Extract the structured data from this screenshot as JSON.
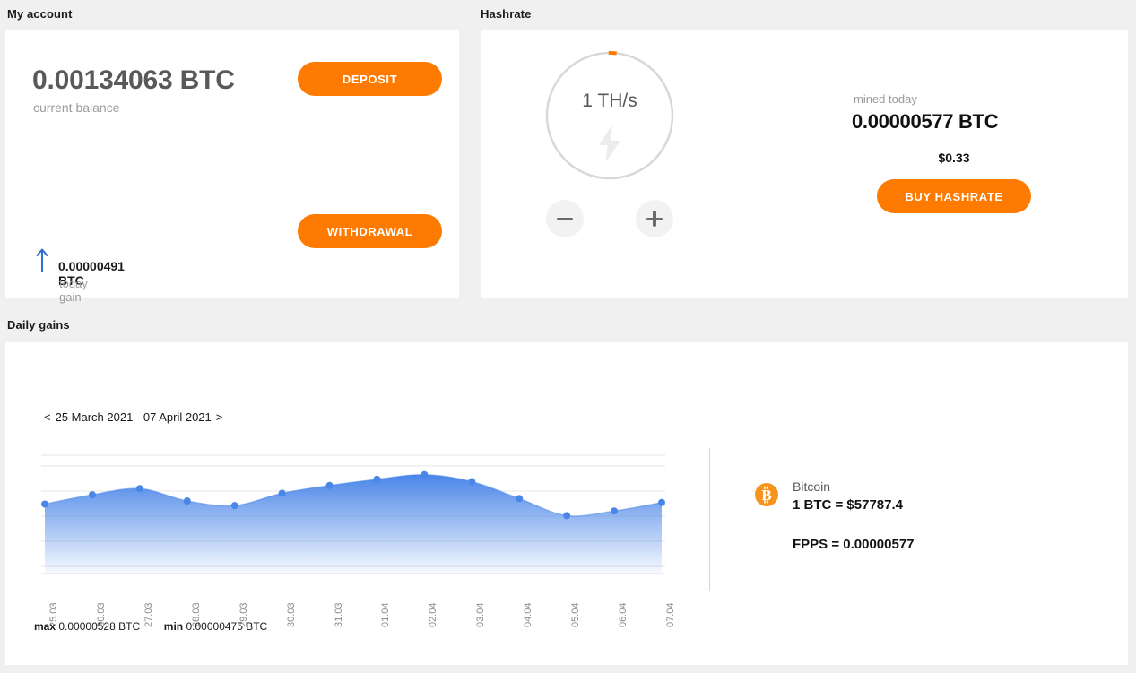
{
  "theme": {
    "accent_orange": "#ff7a00",
    "chart_blue": "#4a86e8",
    "background": "#f0f0f0",
    "panel": "#ffffff"
  },
  "account": {
    "section_title": "My account",
    "balance_amount": "0.00134063 BTC",
    "balance_label": "current balance",
    "deposit_label": "DEPOSIT",
    "withdrawal_label": "WITHDRAWAL",
    "gain_amount": "0.00000491 BTC",
    "gain_label": "today gain",
    "gain_direction_icon": "arrow-up-icon"
  },
  "hashrate": {
    "section_title": "Hashrate",
    "gauge_value": "1 TH/s",
    "gauge_icon": "lightning-bolt-icon",
    "gauge_percent": 2,
    "decrease_label": "−",
    "increase_label": "+",
    "mined_label": "mined today",
    "mined_amount": "0.00000577 BTC",
    "mined_usd": "$0.33",
    "buy_label": "BUY HASHRATE"
  },
  "daily_gains": {
    "section_title": "Daily gains",
    "prev_arrow": "<",
    "next_arrow": ">",
    "date_range": "25 March 2021 - 07 April 2021",
    "max_key": "max",
    "max_value": "0.00000528 BTC",
    "min_key": "min",
    "min_value": "0.00000475 BTC",
    "coin": {
      "icon": "bitcoin-icon",
      "name": "Bitcoin",
      "rate": "1 BTC = $57787.4",
      "fpps": "FPPS = 0.00000577"
    }
  },
  "chart_data": {
    "type": "area",
    "title": "Daily gains",
    "xlabel": "",
    "ylabel": "",
    "grid": true,
    "legend": "none",
    "categories": [
      "25.03",
      "26.03",
      "27.03",
      "28.03",
      "29.03",
      "30.03",
      "31.03",
      "01.04",
      "02.04",
      "03.04",
      "04.04",
      "05.04",
      "06.04",
      "07.04"
    ],
    "values": [
      4.9e-06,
      5.02e-06,
      5.1e-06,
      4.94e-06,
      4.88e-06,
      5.04e-06,
      5.14e-06,
      5.22e-06,
      5.28e-06,
      5.19e-06,
      4.97e-06,
      4.75e-06,
      4.81e-06,
      4.92e-06
    ],
    "ylim": [
      4e-06,
      5.3e-06
    ],
    "max_label": "max 0.00000528 BTC",
    "min_label": "min 0.00000475 BTC",
    "unit": "BTC",
    "series": [
      {
        "name": "daily gain",
        "values": [
          4.9e-06,
          5.02e-06,
          5.1e-06,
          4.94e-06,
          4.88e-06,
          5.04e-06,
          5.14e-06,
          5.22e-06,
          5.28e-06,
          5.19e-06,
          4.97e-06,
          4.75e-06,
          4.81e-06,
          4.92e-06
        ]
      }
    ]
  }
}
